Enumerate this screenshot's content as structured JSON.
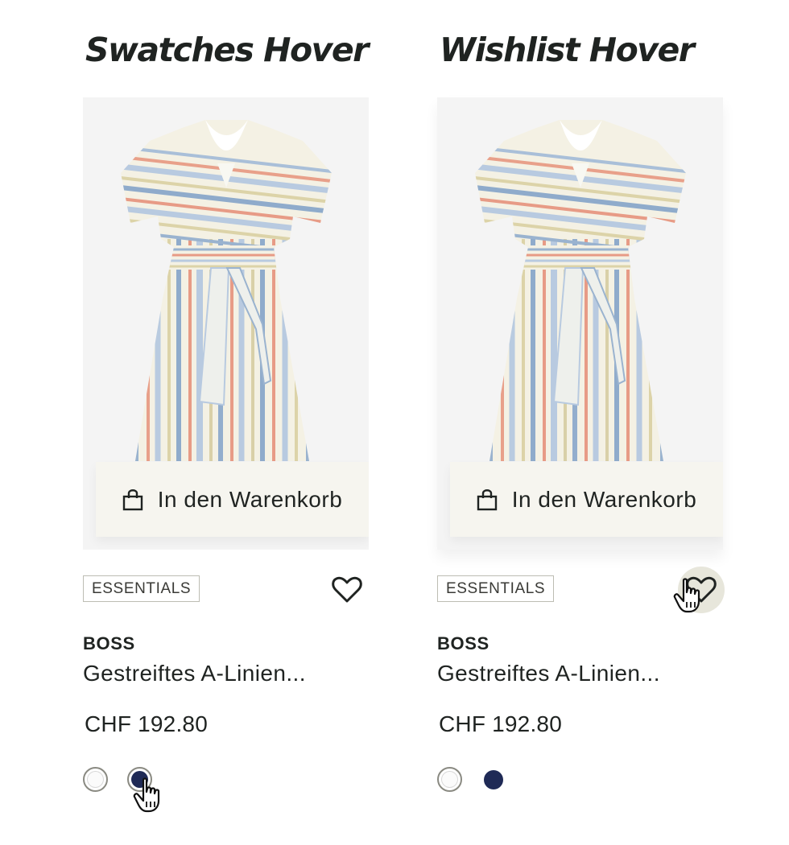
{
  "columns": [
    {
      "heading": "Swatches Hover",
      "cart_label": "In den Warenkorb",
      "badge": "ESSENTIALS",
      "brand": "BOSS",
      "product_name": "Gestreiftes A-Linien...",
      "price": "CHF 192.80",
      "swatches": [
        "white",
        "navy"
      ],
      "hover_target": "navy-swatch"
    },
    {
      "heading": "Wishlist Hover",
      "cart_label": "In den Warenkorb",
      "badge": "ESSENTIALS",
      "brand": "BOSS",
      "product_name": "Gestreiftes A-Linien...",
      "price": "CHF 192.80",
      "swatches": [
        "white",
        "navy"
      ],
      "hover_target": "wishlist-button"
    }
  ],
  "colors": {
    "background": "#ffffff",
    "card": "#f4f4f4",
    "cart_button": "#f6f5ef",
    "text": "#1f2321",
    "badge_border": "#bdbdb3",
    "wishlist_hover": "#e7e6db",
    "swatch_navy": "#1f2a56",
    "swatch_white": "#ffffff"
  },
  "icons": [
    "shopping-bag-icon",
    "heart-icon",
    "hand-cursor-icon"
  ]
}
